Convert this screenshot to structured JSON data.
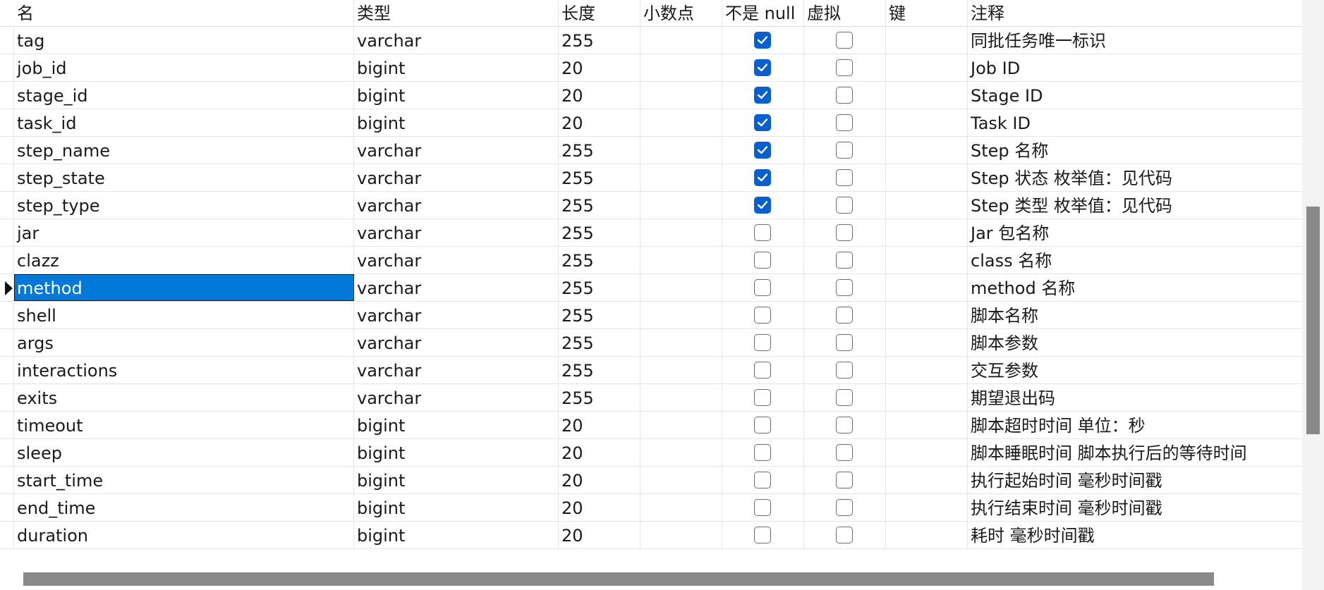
{
  "headers": {
    "name": "名",
    "type": "类型",
    "length": "长度",
    "decimals": "小数点",
    "not_null": "不是 null",
    "virtual": "虚拟",
    "key": "键",
    "comment": "注释"
  },
  "selected_field": "method",
  "rows": [
    {
      "name": "tag",
      "type": "varchar",
      "length": "255",
      "decimals": "",
      "not_null": true,
      "virtual": false,
      "key": "",
      "comment": "同批任务唯一标识"
    },
    {
      "name": "job_id",
      "type": "bigint",
      "length": "20",
      "decimals": "",
      "not_null": true,
      "virtual": false,
      "key": "",
      "comment": "Job ID"
    },
    {
      "name": "stage_id",
      "type": "bigint",
      "length": "20",
      "decimals": "",
      "not_null": true,
      "virtual": false,
      "key": "",
      "comment": "Stage ID"
    },
    {
      "name": "task_id",
      "type": "bigint",
      "length": "20",
      "decimals": "",
      "not_null": true,
      "virtual": false,
      "key": "",
      "comment": "Task ID"
    },
    {
      "name": "step_name",
      "type": "varchar",
      "length": "255",
      "decimals": "",
      "not_null": true,
      "virtual": false,
      "key": "",
      "comment": "Step 名称"
    },
    {
      "name": "step_state",
      "type": "varchar",
      "length": "255",
      "decimals": "",
      "not_null": true,
      "virtual": false,
      "key": "",
      "comment": "Step 状态 枚举值：见代码"
    },
    {
      "name": "step_type",
      "type": "varchar",
      "length": "255",
      "decimals": "",
      "not_null": true,
      "virtual": false,
      "key": "",
      "comment": "Step 类型 枚举值：见代码"
    },
    {
      "name": "jar",
      "type": "varchar",
      "length": "255",
      "decimals": "",
      "not_null": false,
      "virtual": false,
      "key": "",
      "comment": "Jar 包名称"
    },
    {
      "name": "clazz",
      "type": "varchar",
      "length": "255",
      "decimals": "",
      "not_null": false,
      "virtual": false,
      "key": "",
      "comment": "class 名称"
    },
    {
      "name": "method",
      "type": "varchar",
      "length": "255",
      "decimals": "",
      "not_null": false,
      "virtual": false,
      "key": "",
      "comment": "method 名称"
    },
    {
      "name": "shell",
      "type": "varchar",
      "length": "255",
      "decimals": "",
      "not_null": false,
      "virtual": false,
      "key": "",
      "comment": "脚本名称"
    },
    {
      "name": "args",
      "type": "varchar",
      "length": "255",
      "decimals": "",
      "not_null": false,
      "virtual": false,
      "key": "",
      "comment": "脚本参数"
    },
    {
      "name": "interactions",
      "type": "varchar",
      "length": "255",
      "decimals": "",
      "not_null": false,
      "virtual": false,
      "key": "",
      "comment": "交互参数"
    },
    {
      "name": "exits",
      "type": "varchar",
      "length": "255",
      "decimals": "",
      "not_null": false,
      "virtual": false,
      "key": "",
      "comment": "期望退出码"
    },
    {
      "name": "timeout",
      "type": "bigint",
      "length": "20",
      "decimals": "",
      "not_null": false,
      "virtual": false,
      "key": "",
      "comment": "脚本超时时间 单位：秒"
    },
    {
      "name": "sleep",
      "type": "bigint",
      "length": "20",
      "decimals": "",
      "not_null": false,
      "virtual": false,
      "key": "",
      "comment": "脚本睡眠时间 脚本执行后的等待时间"
    },
    {
      "name": "start_time",
      "type": "bigint",
      "length": "20",
      "decimals": "",
      "not_null": false,
      "virtual": false,
      "key": "",
      "comment": "执行起始时间 毫秒时间戳"
    },
    {
      "name": "end_time",
      "type": "bigint",
      "length": "20",
      "decimals": "",
      "not_null": false,
      "virtual": false,
      "key": "",
      "comment": "执行结束时间 毫秒时间戳"
    },
    {
      "name": "duration",
      "type": "bigint",
      "length": "20",
      "decimals": "",
      "not_null": false,
      "virtual": false,
      "key": "",
      "comment": "耗时 毫秒时间戳"
    }
  ],
  "colors": {
    "selection": "#0078d7",
    "checkbox_checked": "#0a5fcf",
    "scrollbar_thumb": "#8a8a8a"
  }
}
